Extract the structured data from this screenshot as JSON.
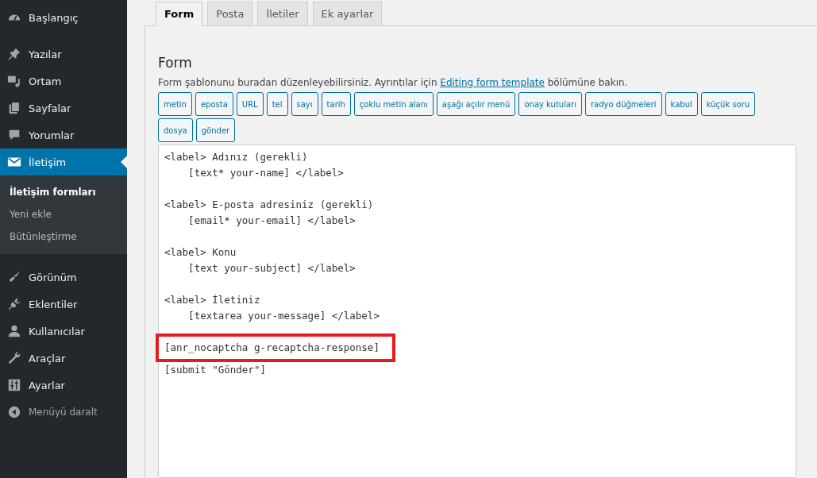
{
  "sidebar": {
    "groups": [
      [
        {
          "label": "Başlangıç",
          "kind": "dashboard",
          "selected": false
        }
      ],
      [
        {
          "label": "Yazılar",
          "kind": "pin",
          "selected": false
        },
        {
          "label": "Ortam",
          "kind": "media",
          "selected": false
        },
        {
          "label": "Sayfalar",
          "kind": "pages",
          "selected": false
        },
        {
          "label": "Yorumlar",
          "kind": "comment",
          "selected": false
        },
        {
          "label": "İletişim",
          "kind": "mail",
          "selected": true,
          "submenu": [
            {
              "label": "İletişim formları",
              "selected": true
            },
            {
              "label": "Yeni ekle",
              "selected": false
            },
            {
              "label": "Bütünleştirme",
              "selected": false
            }
          ]
        }
      ],
      [
        {
          "label": "Görünüm",
          "kind": "brush",
          "selected": false
        },
        {
          "label": "Eklentiler",
          "kind": "plug",
          "selected": false
        },
        {
          "label": "Kullanıcılar",
          "kind": "user",
          "selected": false
        },
        {
          "label": "Araçlar",
          "kind": "wrench",
          "selected": false
        },
        {
          "label": "Ayarlar",
          "kind": "sliders",
          "selected": false
        }
      ]
    ],
    "collapse": "Menüyü daralt"
  },
  "tabs": [
    {
      "label": "Form",
      "selected": true
    },
    {
      "label": "Posta",
      "selected": false
    },
    {
      "label": "İletiler",
      "selected": false
    },
    {
      "label": "Ek ayarlar",
      "selected": false
    }
  ],
  "section": {
    "title": "Form",
    "intro_before": "Form şablonunu buradan düzenleyebilirsiniz. Ayrıntılar için",
    "link": "Editing form template",
    "intro_after": "bölümüne bakın.",
    "tag_buttons": [
      "metin",
      "eposta",
      "URL",
      "tel",
      "sayı",
      "tarih",
      "çoklu metin alanı",
      "aşağı açılır menü",
      "onay kutuları",
      "radyo düğmeleri",
      "kabul",
      "küçük soru",
      "dosya",
      "gönder"
    ],
    "editor_blocks": [
      [
        {
          "text": "<label> Adınız (gerekli)",
          "highlighted": false
        },
        {
          "text": "    [text* your-name] </label>",
          "highlighted": false
        }
      ],
      [
        {
          "text": "<label> E-posta adresiniz (gerekli)",
          "highlighted": false
        },
        {
          "text": "    [email* your-email] </label>",
          "highlighted": false
        }
      ],
      [
        {
          "text": "<label> Konu",
          "highlighted": false
        },
        {
          "text": "    [text your-subject] </label>",
          "highlighted": false
        }
      ],
      [
        {
          "text": "<label> İletiniz",
          "highlighted": false
        },
        {
          "text": "    [textarea your-message] </label>",
          "highlighted": false
        }
      ],
      [
        {
          "text": "[anr_nocaptcha g-recaptcha-response]",
          "highlighted": true
        },
        {
          "text": "[submit \"Gönder\"]",
          "highlighted": false
        }
      ]
    ]
  }
}
